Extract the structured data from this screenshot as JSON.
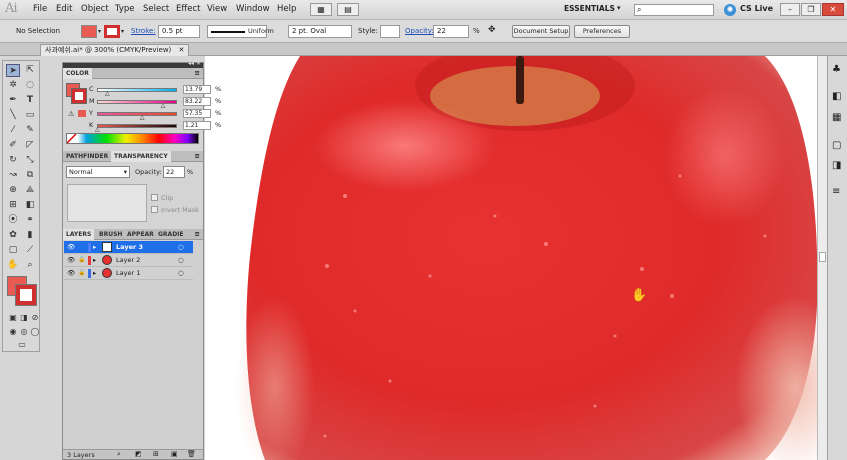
{
  "app": {
    "logo": "Ai"
  },
  "menu": [
    "File",
    "Edit",
    "Object",
    "Type",
    "Select",
    "Effect",
    "View",
    "Window",
    "Help"
  ],
  "workspace": {
    "label": "ESSENTIALS",
    "cslive": "CS Live"
  },
  "control_bar": {
    "selection": "No Selection",
    "stroke_label": "Stroke:",
    "stroke_value": "0.5 pt",
    "profile": "Uniform",
    "brush": "2 pt. Oval",
    "style_label": "Style:",
    "opacity_label": "Opacity:",
    "opacity_value": "22",
    "percent": "%",
    "doc_setup": "Document Setup",
    "preferences": "Preferences"
  },
  "document_tab": {
    "title": "사과예쉬.ai* @ 300% (CMYK/Preview)",
    "close": "✕"
  },
  "color_panel": {
    "title": "COLOR",
    "channels": [
      {
        "name": "C",
        "value": "13.79",
        "level": 0.1379
      },
      {
        "name": "M",
        "value": "83.22",
        "level": 0.8322
      },
      {
        "name": "Y",
        "value": "57.35",
        "level": 0.5735
      },
      {
        "name": "K",
        "value": "1.21",
        "level": 0.0121
      }
    ],
    "percent": "%"
  },
  "transparency_panel": {
    "tabs": [
      "PATHFINDER",
      "TRANSPARENCY"
    ],
    "blend_mode": "Normal",
    "opacity_label": "Opacity:",
    "opacity_value": "22",
    "percent": "%",
    "clip": "Clip",
    "invert_mask": "Invert Mask"
  },
  "layers_panel": {
    "tabs": [
      "LAYERS",
      "BRUSH",
      "APPEAR",
      "GRADIE"
    ],
    "layers": [
      {
        "name": "Layer 3",
        "color": "#4d7cff",
        "selected": true
      },
      {
        "name": "Layer 2",
        "color": "#e23b3b",
        "selected": false
      },
      {
        "name": "Layer 1",
        "color": "#3b6fe2",
        "selected": false
      }
    ],
    "footer": "3 Layers"
  },
  "colors": {
    "accent": "#1e6fe8",
    "fill": "#e95a52",
    "apple": "#e52b2b"
  }
}
